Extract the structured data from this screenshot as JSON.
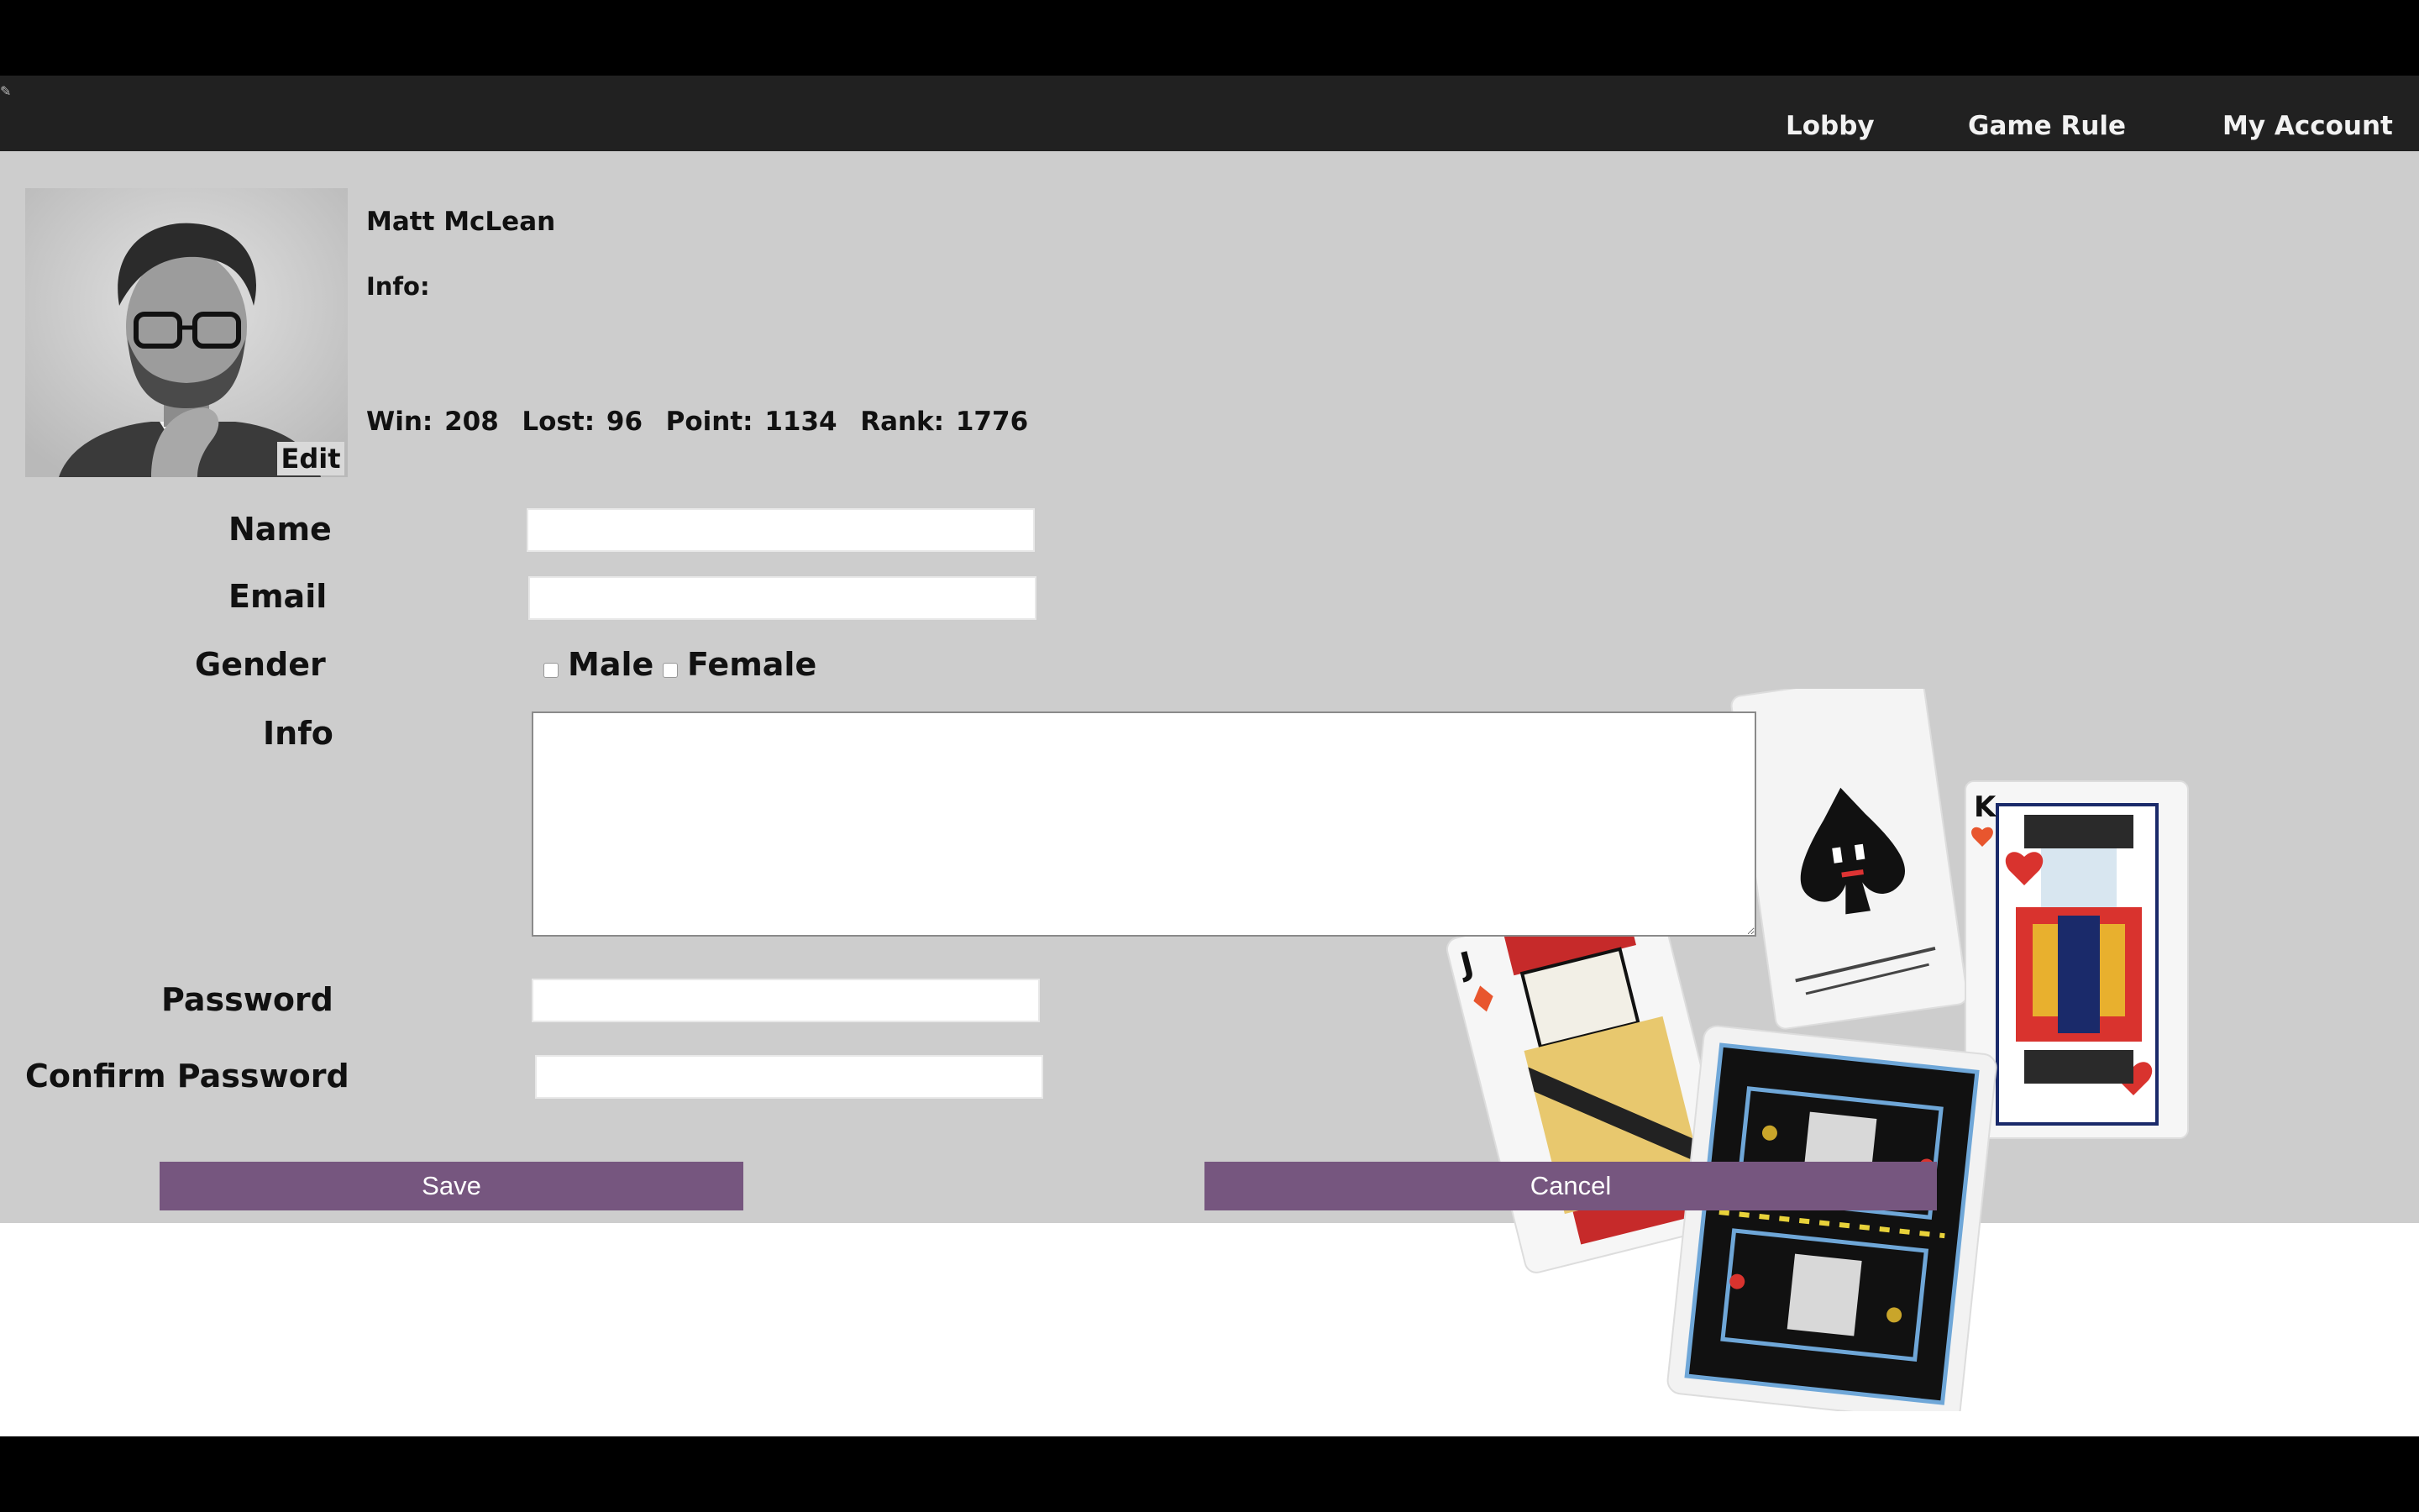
{
  "nav": {
    "links": [
      "Lobby",
      "Game Rule",
      "My Account"
    ]
  },
  "profile": {
    "name": "Matt McLean",
    "info_label": "Info:",
    "edit_label": "Edit",
    "stats": "Win: 208  Lost: 96  Point: 1134  Rank: 1776"
  },
  "form": {
    "name_label": "Name",
    "name_value": "",
    "email_label": "Email",
    "email_value": "",
    "gender_label": "Gender",
    "gender_options": [
      "Male",
      "Female"
    ],
    "info_label": "Info",
    "info_value": "",
    "password_label": "Password",
    "password_value": "",
    "confirm_password_label": "Confirm Password",
    "confirm_password_value": ""
  },
  "buttons": {
    "save": "Save",
    "cancel": "Cancel"
  },
  "colors": {
    "navbar": "#212121",
    "content_bg": "#cdcdcd",
    "button": "#76567f"
  },
  "decor": {
    "cards": [
      "Jack of diamonds",
      "Ace of spades",
      "King of hearts",
      "card back"
    ]
  }
}
